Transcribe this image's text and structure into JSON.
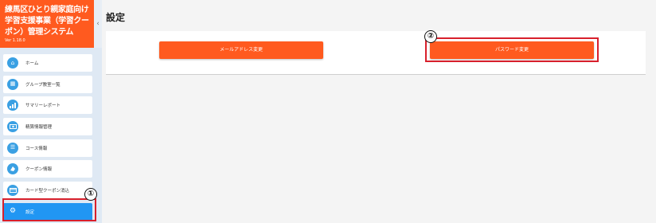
{
  "app": {
    "title": "練馬区ひとり親家庭向け学習支援事業（学習クーポン）管理システム",
    "version": "Ver 1.18.0"
  },
  "sidebar": {
    "collapse_icon": "chevron-left-icon",
    "items": [
      {
        "label": "ホーム",
        "icon": "home-icon"
      },
      {
        "label": "グループ教室一覧",
        "icon": "building-icon"
      },
      {
        "label": "サマリーレポート",
        "icon": "bar-chart-icon"
      },
      {
        "label": "精算情報管理",
        "icon": "money-icon"
      },
      {
        "label": "コース情報",
        "icon": "list-icon"
      },
      {
        "label": "クーポン情報",
        "icon": "ticket-icon"
      },
      {
        "label": "カード型クーポン消込",
        "icon": "card-icon"
      },
      {
        "label": "設定",
        "icon": "gear-icon",
        "active": true
      }
    ]
  },
  "main": {
    "title": "設定",
    "email_button": "メールアドレス変更",
    "password_button": "パスワード変更"
  },
  "annotations": {
    "marker1": "①",
    "marker2": "②",
    "highlight_color": "#d8202c"
  },
  "colors": {
    "accent": "#ff5a1f",
    "active": "#2196f3",
    "icon_bg": "#3aa0e3"
  }
}
